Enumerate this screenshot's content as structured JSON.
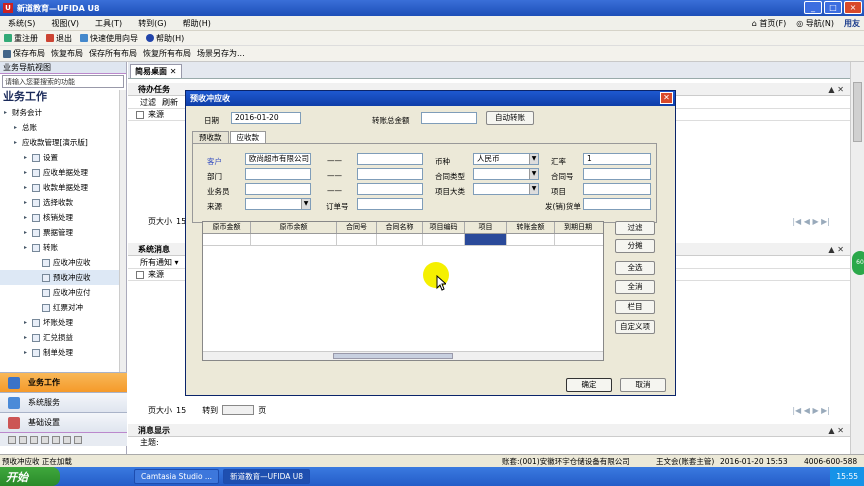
{
  "window": {
    "title": "新道教育—UFIDA U8"
  },
  "menu": [
    "系统(S)",
    "视图(V)",
    "工具(T)",
    "转到(G)",
    "帮助(H)"
  ],
  "menu_right": {
    "home": "首页(F)",
    "nav": "导航(N)",
    "brand": "用友"
  },
  "toolbar1": [
    "重注册",
    "退出",
    "快速使用向导",
    "帮助(H)"
  ],
  "toolbar2": [
    "保存布局",
    "恢复布局",
    "保存所有布局",
    "恢复所有布局",
    "场景另存为..."
  ],
  "sidebar": {
    "header": "业务导航视图",
    "search_placeholder": "请输入您要搜索的功能",
    "title": "业务工作",
    "tree": [
      {
        "label": "财务会计",
        "indent": 0
      },
      {
        "label": "总账",
        "indent": 1
      },
      {
        "label": "应收款管理[演示版]",
        "indent": 1
      },
      {
        "label": "设置",
        "indent": 2
      },
      {
        "label": "应收单据处理",
        "indent": 2
      },
      {
        "label": "收款单据处理",
        "indent": 2
      },
      {
        "label": "选择收款",
        "indent": 2
      },
      {
        "label": "核销处理",
        "indent": 2
      },
      {
        "label": "票据管理",
        "indent": 2
      },
      {
        "label": "转账",
        "indent": 2
      },
      {
        "label": "应收冲应收",
        "indent": 3
      },
      {
        "label": "预收冲应收",
        "indent": 3
      },
      {
        "label": "应收冲应付",
        "indent": 3
      },
      {
        "label": "红票对冲",
        "indent": 3
      },
      {
        "label": "坏账处理",
        "indent": 2
      },
      {
        "label": "汇兑损益",
        "indent": 2
      },
      {
        "label": "制单处理",
        "indent": 2
      }
    ],
    "selected_index": 11,
    "bottom": [
      "业务工作",
      "系统服务",
      "基础设置"
    ]
  },
  "main": {
    "tab": "简易桌面",
    "panel1": {
      "title": "待办任务",
      "filter": "过滤",
      "refresh": "刷新",
      "source": "来源",
      "page_size_label": "页大小",
      "page_size": "15",
      "goto_label": "转到",
      "page_label": "页"
    },
    "panel2": {
      "title": "系统消息",
      "notice": "所有通知",
      "source": "来源",
      "page_size_label": "页大小",
      "page_size": "15",
      "goto_label": "转到",
      "page_label": "页"
    },
    "panel3": {
      "title": "消息显示",
      "subject": "主题:"
    }
  },
  "dialog": {
    "title": "预收冲应收",
    "date_label": "日期",
    "date_value": "2016-01-20",
    "total_label": "转账总金额",
    "auto_btn": "自动转账",
    "tabs": [
      "预收款",
      "应收款"
    ],
    "active_tab": 1,
    "customer_label": "客户",
    "customer_value": "欧尚超市有限公司",
    "dept_label": "部门",
    "salesman_label": "业务员",
    "source_label": "来源",
    "order_label": "订单号",
    "currency_label": "币种",
    "currency_value": "人民币",
    "contract_type_label": "合同类型",
    "project_class_label": "项目大类",
    "rate_label": "汇率",
    "rate_value": "1",
    "contract_no_label": "合同号",
    "project_label": "项目",
    "invoice_label": "发(销)货单",
    "dash": "——",
    "grid_headers": [
      "原币金额",
      "原币余额",
      "合同号",
      "合同名称",
      "项目编码",
      "项目",
      "转账金额",
      "到期日期"
    ],
    "side_buttons": [
      "过滤",
      "分摊",
      "全选",
      "全消",
      "栏目",
      "自定义项"
    ],
    "ok": "确定",
    "cancel": "取消"
  },
  "status": {
    "left": "预收冲应收 正在加载",
    "account": "账套:(001)安徽环宇仓储设备有限公司",
    "user": "王文会(账套主管)",
    "datetime": "2016-01-20 15:53",
    "phone": "4006-600-588"
  },
  "taskbar": {
    "start": "开始",
    "tasks": [
      "Camtasia Studio ...",
      "新道教育—UFIDA U8"
    ],
    "time": "15:55"
  }
}
